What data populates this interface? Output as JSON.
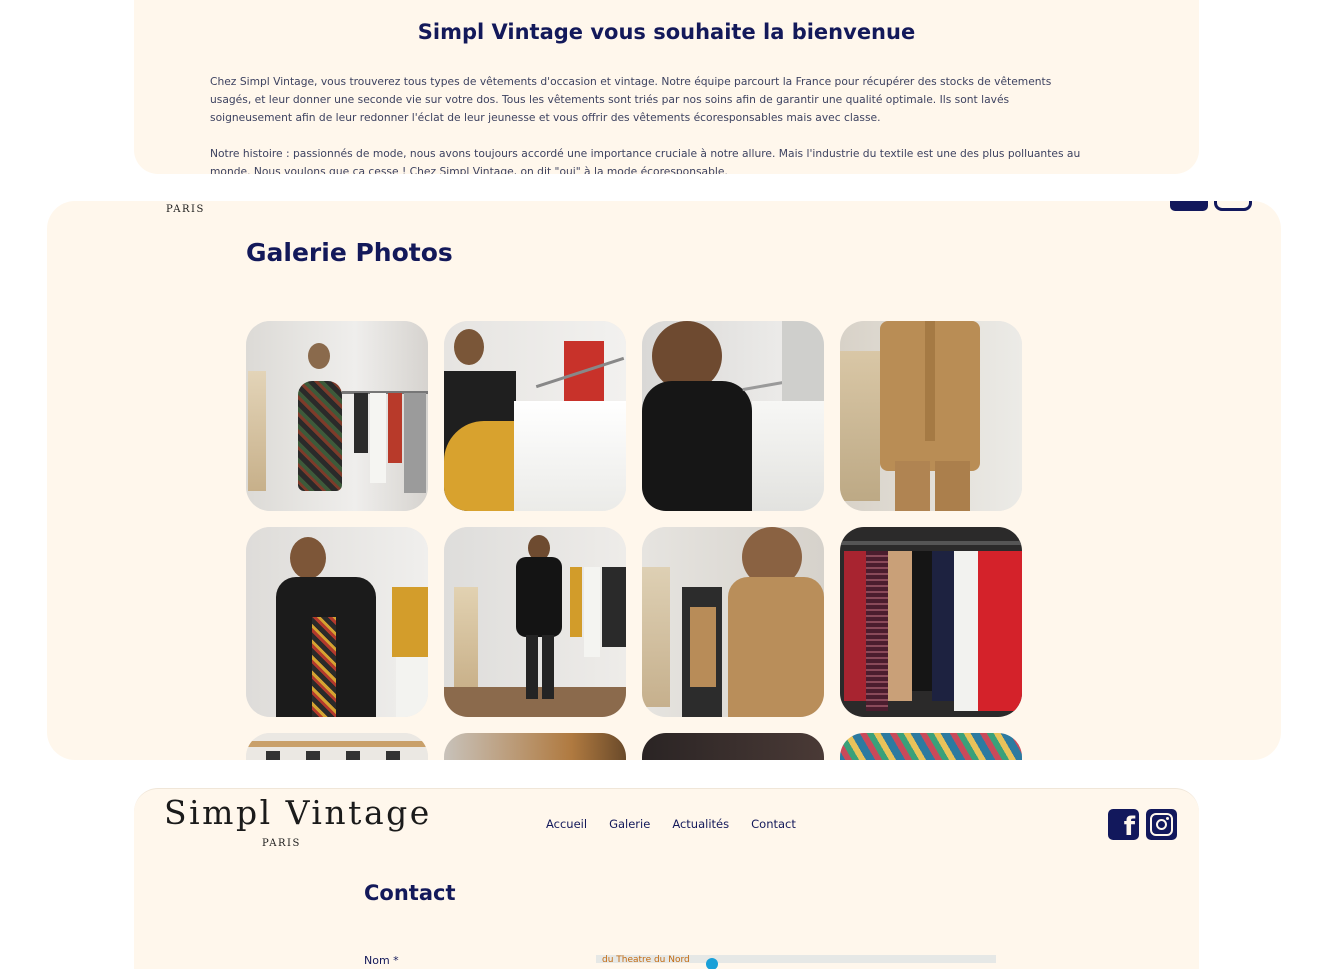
{
  "welcome": {
    "title": "Simpl Vintage vous souhaite la bienvenue",
    "paragraph1": "Chez Simpl Vintage, vous trouverez tous types de vêtements d'occasion et vintage. Notre équipe parcourt la France pour récupérer des stocks de vêtements usagés, et leur donner une seconde vie sur votre dos. Tous les vêtements sont triés par nos soins afin de garantir une qualité optimale. Ils sont lavés soigneusement afin de leur redonner l'éclat de leur jeunesse et vous offrir des vêtements écoresponsables mais avec classe.",
    "paragraph2": "Notre histoire : passionnés de mode, nous avons toujours accordé une importance cruciale à notre allure. Mais l'industrie du textile est une des plus polluantes au monde. Nous voulons que ça cesse ! Chez Simpl Vintage, on dit \"oui\" à la mode écoresponsable."
  },
  "gallery": {
    "logo_sub": "PARIS",
    "title": "Galerie Photos",
    "photos": [
      "woman-floral-dress-browsing-rack",
      "woman-black-top-browsing-hangers",
      "woman-black-top-closeup-hangers",
      "beige-suit-jacket",
      "woman-black-blazer-floral-dress",
      "woman-holding-black-jacket",
      "woman-beige-suit-mirror",
      "colorful-coats-on-rack",
      "clothing-rail-partial",
      "store-partial",
      "dark-photo-partial",
      "colorful-patterns-partial"
    ]
  },
  "header": {
    "brand_name": "Simpl Vintage",
    "brand_sub": "PARIS",
    "nav": [
      "Accueil",
      "Galerie",
      "Actualités",
      "Contact"
    ],
    "social": [
      "facebook-icon",
      "instagram-icon"
    ]
  },
  "contact": {
    "title": "Contact",
    "name_label": "Nom *",
    "map_label": "du Theatre du Nord"
  },
  "colors": {
    "panel_bg": "#fff7ec",
    "navy": "#13195a",
    "body_text": "#3d4260"
  }
}
